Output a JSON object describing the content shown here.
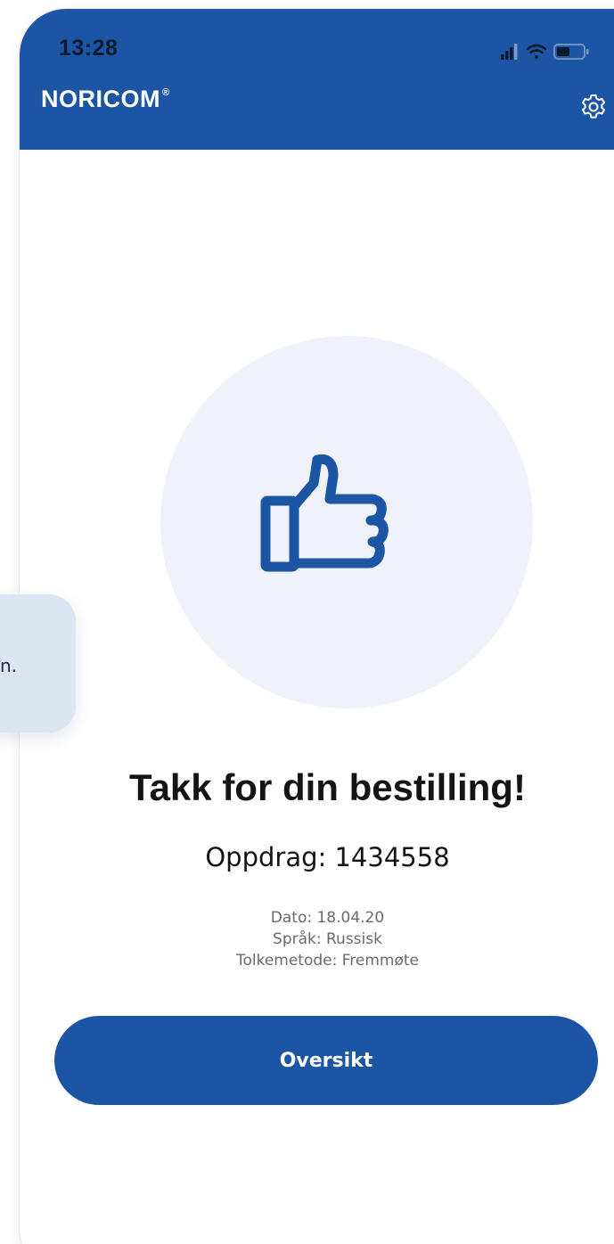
{
  "status_bar": {
    "time": "13:28",
    "icons": [
      "signal-icon",
      "wifi-icon",
      "battery-icon"
    ]
  },
  "header": {
    "brand": "NORICOM",
    "trademark": "®",
    "settings_icon": "gear-icon"
  },
  "side_bubble": {
    "text": "n."
  },
  "confirmation": {
    "icon": "thumbs-up-icon",
    "title": "Takk for din bestilling!",
    "order_label": "Oppdrag: 1434558",
    "details": {
      "date": "Dato: 18.04.20",
      "language": "Språk: Russisk",
      "method": "Tolkemetode: Fremmøte"
    }
  },
  "primary_button": {
    "label": "Oversikt"
  },
  "colors": {
    "brand_blue": "#1d55a5",
    "hero_bg": "#eff3f9",
    "bubble_bg": "#dce5f2"
  }
}
